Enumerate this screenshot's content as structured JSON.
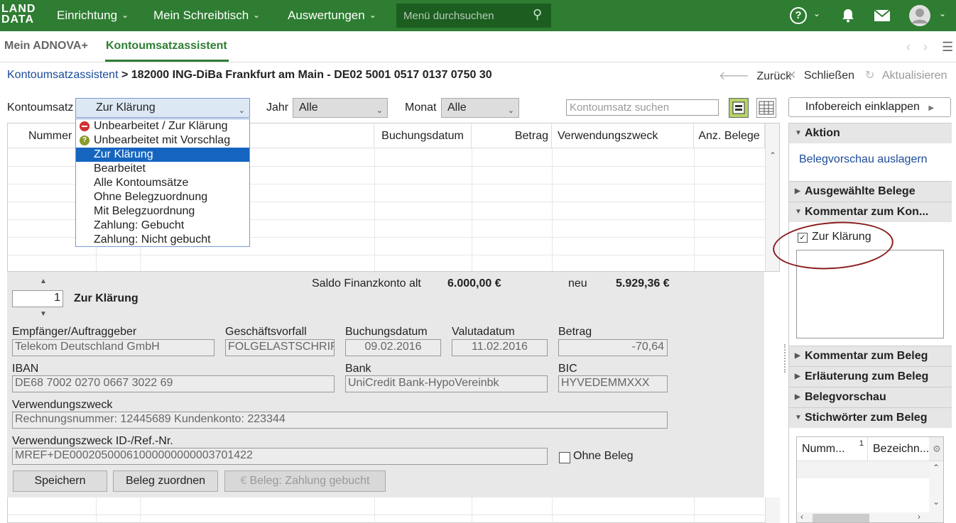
{
  "app": {
    "logo_top": "LAND",
    "logo_bottom": "DATA",
    "nav": [
      {
        "label": "Einrichtung"
      },
      {
        "label": "Mein Schreibtisch"
      },
      {
        "label": "Auswertungen"
      }
    ],
    "menu_search_placeholder": "Menü durchsuchen",
    "brand_color": "#2e7d32"
  },
  "tabs": {
    "home": "Mein ADNOVA+",
    "active": "Kontoumsatzassistent"
  },
  "breadcrumb": {
    "link": "Kontoumsatzassistent",
    "sep": ">",
    "current": "182000 ING-DiBa Frankfurt am Main - DE02 5001 0517 0137 0750 30"
  },
  "toolbar": {
    "back": "Zurück",
    "close": "Schließen",
    "refresh": "Aktualisieren"
  },
  "filters": {
    "kontoumsatz_label": "Kontoumsatz",
    "kontoumsatz_value": "Zur Klärung",
    "jahr_label": "Jahr",
    "jahr_value": "Alle",
    "monat_label": "Monat",
    "monat_value": "Alle",
    "search_placeholder": "Kontoumsatz suchen"
  },
  "dropdown": {
    "options": [
      {
        "label": "Unbearbeitet / Zur Klärung",
        "icon": "red-minus-icon"
      },
      {
        "label": "Unbearbeitet mit Vorschlag",
        "icon": "olive-question-icon"
      },
      {
        "label": "Zur Klärung",
        "selected": true
      },
      {
        "label": "Bearbeitet"
      },
      {
        "label": "Alle Kontoumsätze"
      },
      {
        "label": "Ohne Belegzuordnung"
      },
      {
        "label": "Mit Belegzuordnung"
      },
      {
        "label": "Zahlung: Gebucht"
      },
      {
        "label": "Zahlung: Nicht gebucht"
      }
    ]
  },
  "grid": {
    "columns": [
      "Nummer",
      "Buchungsdatum",
      "Betrag",
      "Verwendungszweck",
      "Anz. Belege"
    ]
  },
  "detail": {
    "saldo_label": "Saldo Finanzkonto alt",
    "saldo_alt": "6.000,00 €",
    "neu_label": "neu",
    "saldo_neu": "5.929,36 €",
    "record_number": "1",
    "status": "Zur Klärung",
    "fields": {
      "empfaenger_label": "Empfänger/Auftraggeber",
      "empfaenger": "Telekom Deutschland GmbH",
      "geschaeftsvorfall_label": "Geschäftsvorfall",
      "geschaeftsvorfall": "FOLGELASTSCHRIF",
      "buchungsdatum_label": "Buchungsdatum",
      "buchungsdatum": "09.02.2016",
      "valutadatum_label": "Valutadatum",
      "valutadatum": "11.02.2016",
      "betrag_label": "Betrag",
      "betrag": "-70,64",
      "iban_label": "IBAN",
      "iban": "DE68 7002 0270 0667 3022 69",
      "bank_label": "Bank",
      "bank": "UniCredit Bank-HypoVereinbk",
      "bic_label": "BIC",
      "bic": "HYVEDEMMXXX",
      "vz_label": "Verwendungszweck",
      "vz": "Rechnungsnummer: 12445689 Kundenkonto: 223344",
      "vzid_label": "Verwendungszweck ID-/Ref.-Nr.",
      "vzid": "MREF+DE00020500061000000000003701422",
      "ohne_beleg": "Ohne Beleg"
    },
    "buttons": {
      "save": "Speichern",
      "assign": "Beleg zuordnen",
      "paid": "Beleg: Zahlung gebucht"
    }
  },
  "right_panel": {
    "collapse": "Infobereich einklappen",
    "aktion": "Aktion",
    "aktion_link": "Belegvorschau auslagern",
    "ausgewaehlte": "Ausgewählte Belege",
    "kommentar_kon": "Kommentar zum Kon...",
    "zur_klaerung": "Zur Klärung",
    "kommentar_beleg": "Kommentar zum Beleg",
    "erlaeuterung": "Erläuterung zum Beleg",
    "belegvorschau": "Belegvorschau",
    "stichwoerter": "Stichwörter zum Beleg",
    "table_col1": "Numm...",
    "table_col1_sort": "1",
    "table_col2": "Bezeichn..."
  }
}
